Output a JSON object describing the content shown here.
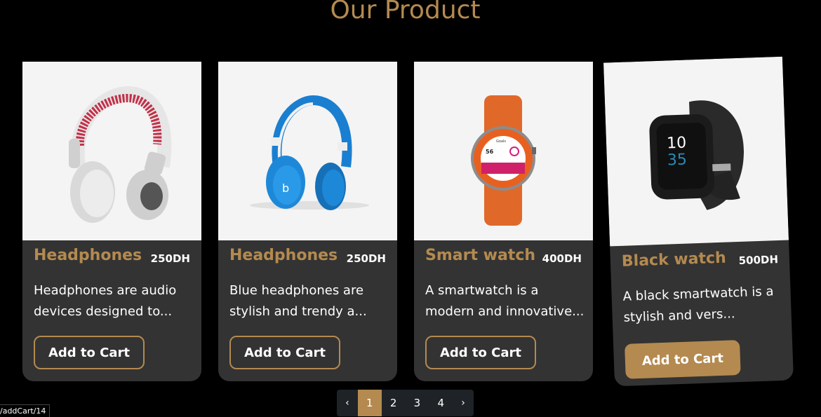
{
  "section": {
    "title": "Our Product"
  },
  "products": [
    {
      "name": "Headphones",
      "price": "250DH",
      "description": "Headphones are audio\ndevices designed to...",
      "button": "Add to Cart",
      "image": "white-red-headphones"
    },
    {
      "name": "Headphones",
      "price": "250DH",
      "description": "Blue headphones are\nstylish and trendy a...",
      "button": "Add to Cart",
      "image": "blue-headphones"
    },
    {
      "name": "Smart watch",
      "price": "400DH",
      "description": "A smartwatch is a\nmodern and innovative...",
      "button": "Add to Cart",
      "image": "orange-smartwatch"
    },
    {
      "name": "Black watch",
      "price": "500DH",
      "description": "A black smartwatch is a\nstylish and vers...",
      "button": "Add to Cart",
      "image": "black-smartwatch"
    }
  ],
  "pagination": {
    "prev": "‹",
    "pages": [
      "1",
      "2",
      "3",
      "4"
    ],
    "active": "1",
    "next": "›"
  },
  "status_bar": {
    "url": "/addCart/14"
  },
  "watch_screen": {
    "time_hour": "10",
    "time_min": "35",
    "steps": "56",
    "goals": "Goals"
  },
  "colors": {
    "accent": "#b48a50",
    "card_bg": "#333333",
    "page_bg": "#000000",
    "image_bg": "#f4f4f4"
  }
}
